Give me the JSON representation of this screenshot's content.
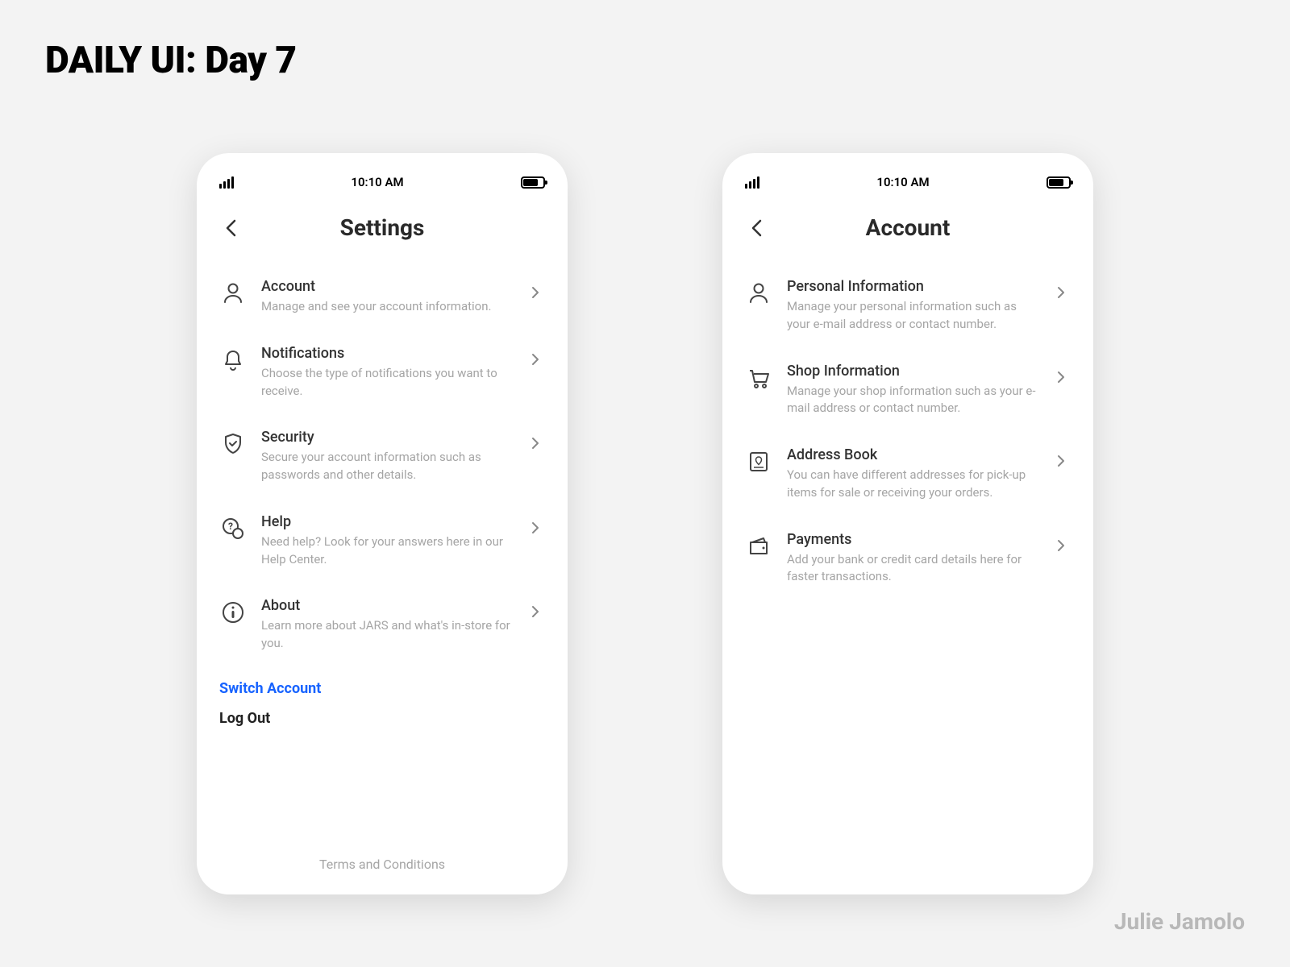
{
  "page": {
    "title": "DAILY UI: Day 7",
    "credit": "Julie Jamolo"
  },
  "status": {
    "time": "10:10 AM"
  },
  "left": {
    "title": "Settings",
    "rows": [
      {
        "title": "Account",
        "sub": "Manage and see your account information."
      },
      {
        "title": "Notifications",
        "sub": "Choose the type of notifications you want to receive."
      },
      {
        "title": "Security",
        "sub": "Secure your account information such as passwords and other details."
      },
      {
        "title": "Help",
        "sub": "Need help? Look for your answers here in our Help Center."
      },
      {
        "title": "About",
        "sub": "Learn more about JARS and what's in-store for you."
      }
    ],
    "switch_account": "Switch Account",
    "log_out": "Log Out",
    "terms": "Terms and Conditions"
  },
  "right": {
    "title": "Account",
    "rows": [
      {
        "title": "Personal Information",
        "sub": "Manage your personal information such as your e-mail address or contact number."
      },
      {
        "title": "Shop Information",
        "sub": "Manage your shop information such as your e-mail address or contact number."
      },
      {
        "title": "Address Book",
        "sub": "You can have different addresses for pick-up items for sale or receiving your orders."
      },
      {
        "title": "Payments",
        "sub": "Add your bank or credit card details here for faster transactions."
      }
    ]
  }
}
